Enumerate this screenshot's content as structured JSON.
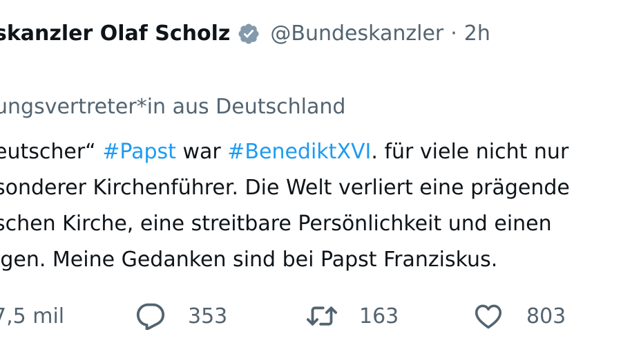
{
  "tweet": {
    "author_name": "skanzler Olaf Scholz",
    "handle": "@Bundeskanzler",
    "separator": "·",
    "time": "2h",
    "label": "ungsvertreter*in aus Deutschland",
    "body": {
      "line1": {
        "text_a": "eutscher“ ",
        "hashtag_1": "#Papst",
        "text_b": " war ",
        "hashtag_2": "#BenediktXVI",
        "text_c": ". für viele nicht nur"
      },
      "line2": "sonderer Kirchenführer. Die Welt verliert eine prägende",
      "line3": "schen Kirche, eine streitbare Persönlichkeit und einen",
      "line4": "igen. Meine Gedanken sind bei Papst Franziskus."
    },
    "actions": {
      "views": "7,5 mil",
      "replies": "353",
      "retweets": "163",
      "likes": "803"
    }
  },
  "colors": {
    "text": "#0f1419",
    "secondary": "#536471",
    "hashtag": "#1d9bf0",
    "verified_badge": "#829aab"
  },
  "icons": {
    "verified": "verified-badge-icon",
    "reply": "reply-icon",
    "retweet": "retweet-icon",
    "like": "heart-icon"
  }
}
